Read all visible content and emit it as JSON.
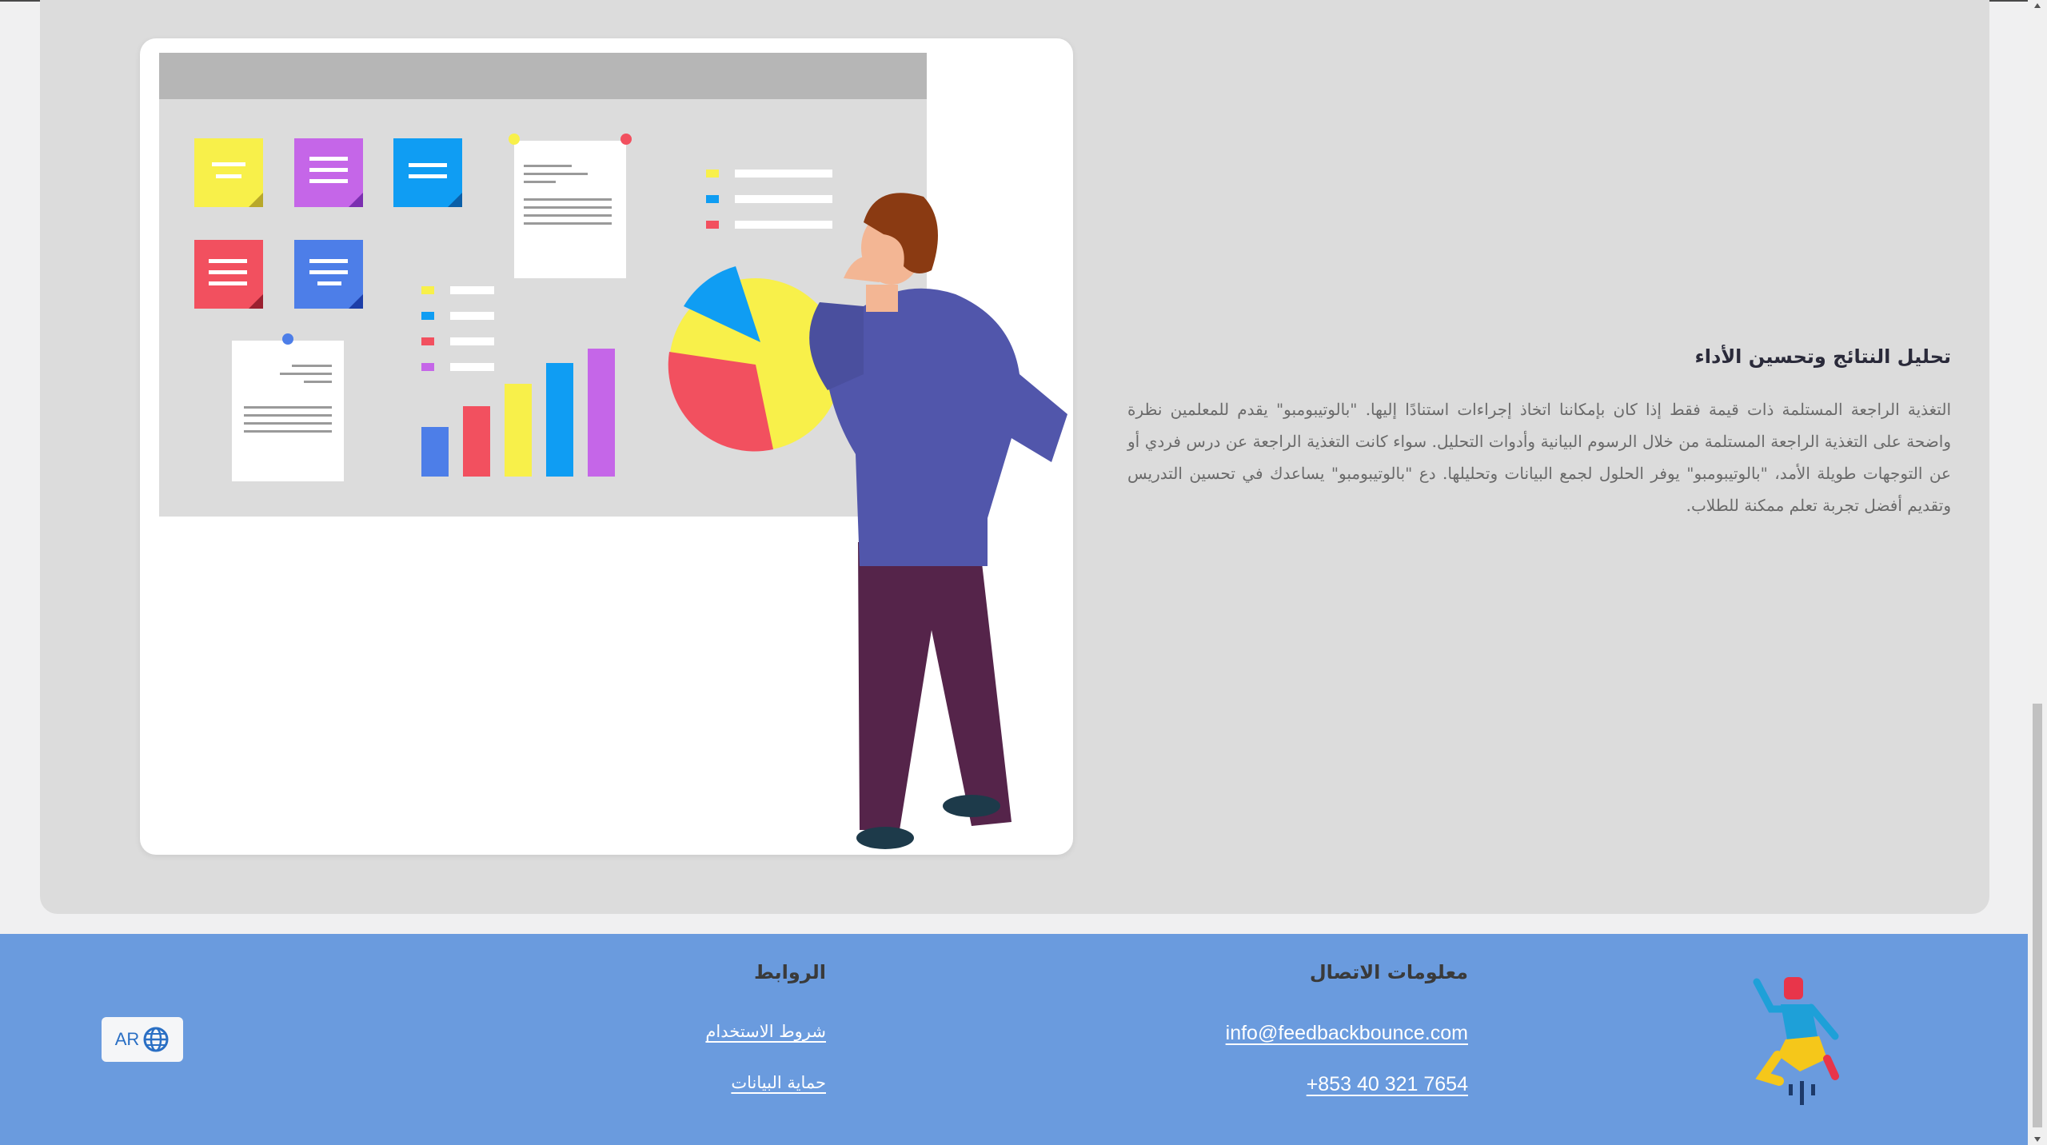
{
  "section": {
    "title": "تحليل النتائج وتحسين الأداء",
    "body": "التغذية الراجعة المستلمة ذات قيمة فقط إذا كان بإمكاننا اتخاذ إجراءات استنادًا إليها. \"بالوتيبومبو\" يقدم للمعلمين نظرة واضحة على التغذية الراجعة المستلمة من خلال الرسوم البيانية وأدوات التحليل. سواء كانت التغذية الراجعة عن درس فردي أو عن التوجهات طويلة الأمد، \"بالوتيبومبو\" يوفر الحلول لجمع البيانات وتحليلها. دع \"بالوتيبومبو\" يساعدك في تحسين التدريس وتقديم أفضل تجربة تعلم ممكنة للطلاب."
  },
  "footer": {
    "language_label": "AR",
    "links_title": "الروابط",
    "links": [
      "شروط الاستخدام",
      "حماية البيانات"
    ],
    "contact_title": "معلومات الاتصال",
    "email": "info@feedbackbounce.com",
    "phone": "+853 40 321 7654"
  },
  "colors": {
    "section_bg": "#dcdcdc",
    "footer_bg": "#6a9bde",
    "accent_blue": "#2a6fc4"
  },
  "icons": {
    "language": "globe-icon",
    "logo": "bouncing-person-logo"
  }
}
